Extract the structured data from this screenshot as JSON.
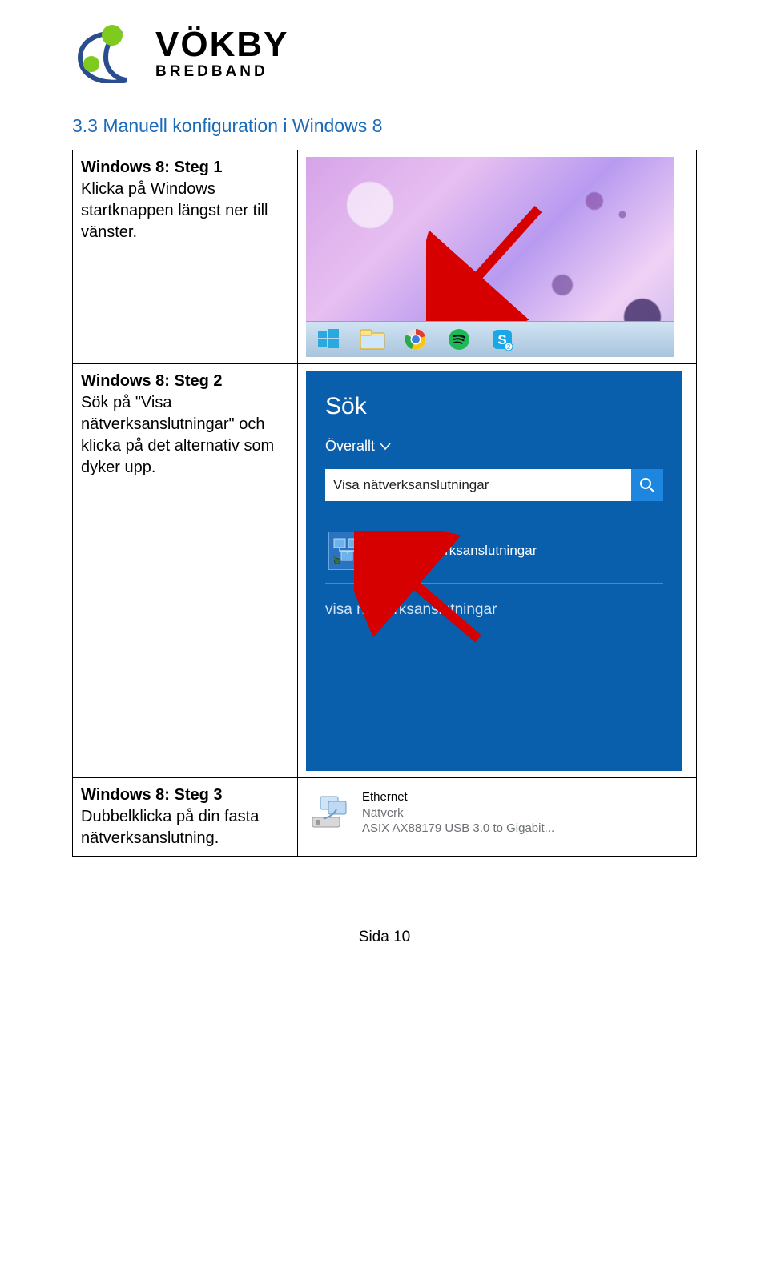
{
  "brand": {
    "name": "VÖKBY",
    "sub": "BREDBAND"
  },
  "section_heading": "3.3 Manuell konfiguration i Windows 8",
  "steps": [
    {
      "title": "Windows 8: Steg 1",
      "body": "Klicka på Windows startknappen längst ner till vänster."
    },
    {
      "title": "Windows 8: Steg 2",
      "body": "Sök på \"Visa nätverksanslutningar\" och klicka på det alternativ som dyker upp."
    },
    {
      "title": "Windows 8: Steg 3",
      "body": "Dubbelklicka på din fasta nätverksanslutning."
    }
  ],
  "search_panel": {
    "heading": "Sök",
    "scope": "Överallt",
    "input_value": "Visa nätverksanslutningar",
    "result": "Visa nätverksanslutningar",
    "suggestion": "visa nätverksanslutningar"
  },
  "ethernet": {
    "name": "Ethernet",
    "status": "Nätverk",
    "device": "ASIX AX88179 USB 3.0 to Gigabit..."
  },
  "footer": "Sida 10"
}
